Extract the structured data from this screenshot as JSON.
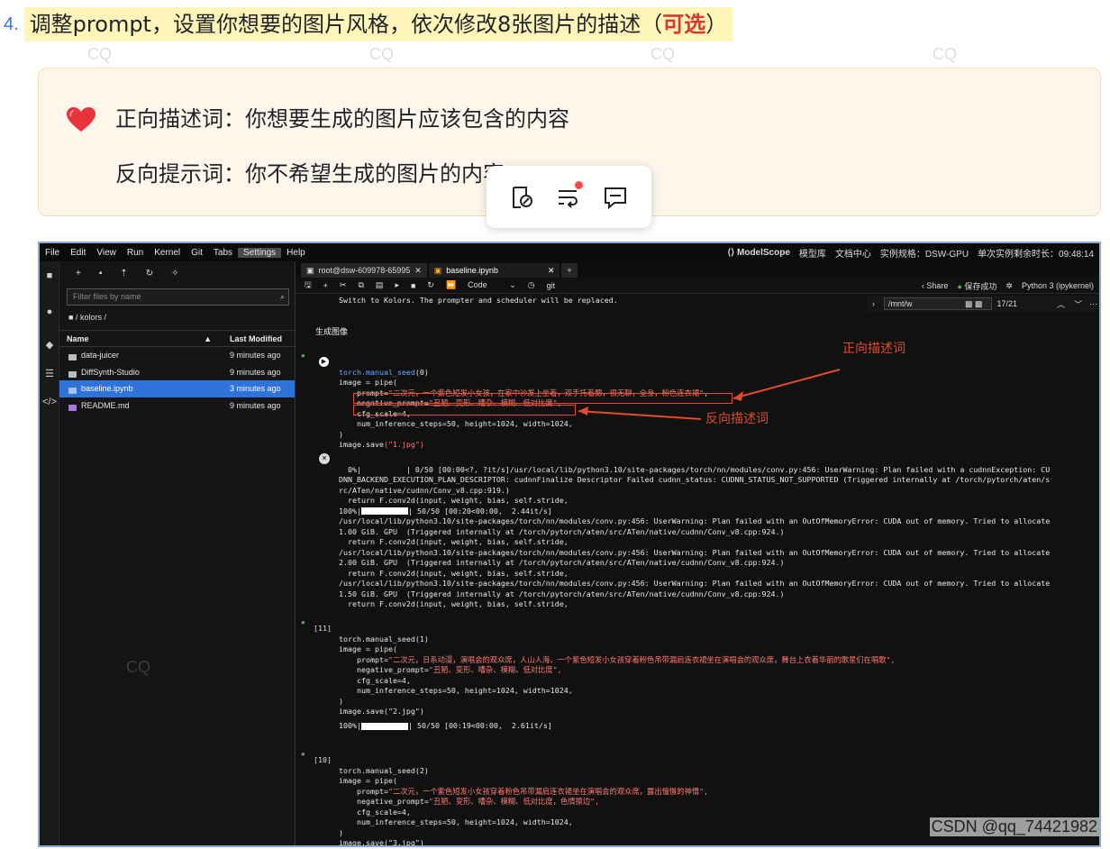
{
  "watermark": "CQ",
  "step": {
    "number": "4.",
    "text": "调整prompt，设置你想要的图片风格，依次修改8张图片的描述（",
    "optional": "可选",
    "close": "）"
  },
  "callout": {
    "line1": "正向描述词：你想要生成的图片应该包含的内容",
    "line2": "反向提示词：你不希望生成的图片的内容"
  },
  "popup": {
    "icons": [
      "link-icon",
      "wrap-text-icon",
      "comment-icon"
    ]
  },
  "colors": {
    "highlight": "#fff5b8",
    "annotation": "#e24b2c",
    "accent": "#3370ff",
    "selected_row": "#2f73d9"
  },
  "menubar": {
    "items": [
      "File",
      "Edit",
      "View",
      "Run",
      "Kernel",
      "Git",
      "Tabs",
      "Settings",
      "Help"
    ],
    "brand": "ModelScope",
    "links": [
      "模型库",
      "文档中心"
    ],
    "instance": "实例规格：DSW-GPU",
    "remaining": "单次实例剩余时长：09:48:14"
  },
  "filebrowser": {
    "filter_placeholder": "Filter files by name",
    "breadcrumb": "■ / kolors /",
    "col_name": "Name",
    "col_modified": "Last Modified",
    "rows": [
      {
        "name": "data-juicer",
        "modified": "9 minutes ago"
      },
      {
        "name": "DiffSynth-Studio",
        "modified": "9 minutes ago"
      },
      {
        "name": "baseline.ipynb",
        "modified": "3 minutes ago"
      },
      {
        "name": "README.md",
        "modified": "9 minutes ago"
      }
    ]
  },
  "tabs": {
    "terminal": "root@dsw-609978-65995",
    "notebook": "baseline.ipynb"
  },
  "toolbar": {
    "cell_type": "Code",
    "git": "git",
    "share": "Share",
    "saved": "保存成功",
    "kernel": "Python 3 (ipykernel)"
  },
  "find": {
    "query": "/mnt/w",
    "count": "17/21"
  },
  "cells": {
    "output_top": "Switch to Kolors. The prompter and scheduler will be replaced.",
    "section_title": "生成图像",
    "c1": {
      "line1_fn": "torch.manual_seed",
      "line1_arg": "(0)",
      "line2": "image = pipe(",
      "prompt_key": "    prompt=",
      "prompt_val": "\"二次元，一个紫色短发小女孩，在家中沙发上坐着，双手托着腮，很无聊，全身，粉色连衣裙\"",
      "neg_key": "    negative_prompt=",
      "neg_val": "\"丑陋、变形、嘈杂、模糊、低对比度\"",
      "cfg": "    cfg_scale=4,",
      "steps": "    num_inference_steps=50, height=1024, width=1024,",
      "close": ")",
      "save_fn": "image.save",
      "save_arg": "(\"1.jpg\")"
    },
    "err": [
      "  0%|          | 0/50 [00:00<?, ?it/s]/usr/local/lib/python3.10/site-packages/torch/nn/modules/conv.py:456: UserWarning: Plan failed with a cudnnException: CU",
      "DNN_BACKEND_EXECUTION_PLAN_DESCRIPTOR: cudnnFinalize Descriptor Failed cudnn_status: CUDNN_STATUS_NOT_SUPPORTED (Triggered internally at /torch/pytorch/aten/s",
      "rc/ATen/native/cudnn/Conv_v8.cpp:919.)",
      "  return F.conv2d(input, weight, bias, self.stride,",
      "| 50/50 [00:20<00:00,  2.44it/s]",
      "/usr/local/lib/python3.10/site-packages/torch/nn/modules/conv.py:456: UserWarning: Plan failed with an OutOfMemoryError: CUDA out of memory. Tried to allocate",
      "1.00 GiB. GPU  (Triggered internally at /torch/pytorch/aten/src/ATen/native/cudnn/Conv_v8.cpp:924.)",
      "  return F.conv2d(input, weight, bias, self.stride,",
      "/usr/local/lib/python3.10/site-packages/torch/nn/modules/conv.py:456: UserWarning: Plan failed with an OutOfMemoryError: CUDA out of memory. Tried to allocate",
      "2.00 GiB. GPU  (Triggered internally at /torch/pytorch/aten/src/ATen/native/cudnn/Conv_v8.cpp:924.)",
      "  return F.conv2d(input, weight, bias, self.stride,",
      "/usr/local/lib/python3.10/site-packages/torch/nn/modules/conv.py:456: UserWarning: Plan failed with an OutOfMemoryError: CUDA out of memory. Tried to allocate",
      "1.50 GiB. GPU  (Triggered internally at /torch/pytorch/aten/src/ATen/native/cudnn/Conv_v8.cpp:924.)",
      "  return F.conv2d(input, weight, bias, self.stride,"
    ],
    "err_pct": "100%",
    "c2": {
      "prompt": "[11]",
      "line1": "torch.manual_seed(1)",
      "line2": "image = pipe(",
      "prompt_key": "    prompt=",
      "prompt_val": "\"二次元，日系动漫，演唱会的观众席，人山人海，一个紫色短发小女孩穿着粉色吊带漏肩连衣裙坐在演唱会的观众席，舞台上衣着华丽的歌星们在唱歌\",",
      "neg_key": "    negative_prompt=",
      "neg_val": "\"丑陋、变形、嘈杂、模糊、低对比度\",",
      "cfg": "    cfg_scale=4,",
      "steps": "    num_inference_steps=50, height=1024, width=1024,",
      "close": ")",
      "save": "image.save(\"2.jpg\")",
      "out_pct": "100%",
      "out": "| 50/50 [00:19<00:00,  2.61it/s]"
    },
    "c3": {
      "prompt": "[10]",
      "line1": "torch.manual_seed(2)",
      "line2": "image = pipe(",
      "prompt_key": "    prompt=",
      "prompt_val": "\"二次元，一个紫色短发小女孩穿着粉色吊带漏肩连衣裙坐在演唱会的观众席，露出憧憬的神情\",",
      "neg_key": "    negative_prompt=",
      "neg_val": "\"丑陋、变形、嘈杂、模糊、低对比度，色情擦边\",",
      "cfg": "    cfg_scale=4,",
      "steps": "    num_inference_steps=50, height=1024, width=1024,",
      "close": ")",
      "save": "image.save(\"3.jpg\")"
    }
  },
  "annotations": {
    "positive": "正向描述词",
    "negative": "反向描述词"
  },
  "footer": "CSDN @qq_74421982"
}
